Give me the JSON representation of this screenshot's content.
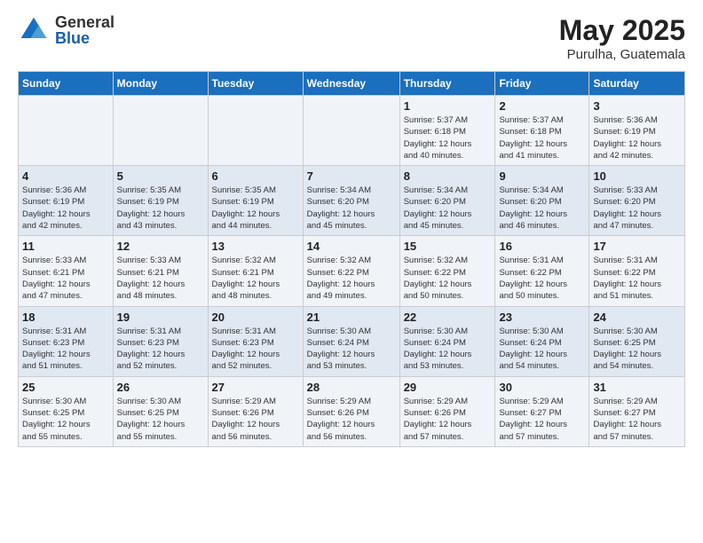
{
  "logo": {
    "general": "General",
    "blue": "Blue"
  },
  "title": "May 2025",
  "location": "Purulha, Guatemala",
  "days_of_week": [
    "Sunday",
    "Monday",
    "Tuesday",
    "Wednesday",
    "Thursday",
    "Friday",
    "Saturday"
  ],
  "weeks": [
    [
      {
        "day": "",
        "info": ""
      },
      {
        "day": "",
        "info": ""
      },
      {
        "day": "",
        "info": ""
      },
      {
        "day": "",
        "info": ""
      },
      {
        "day": "1",
        "info": "Sunrise: 5:37 AM\nSunset: 6:18 PM\nDaylight: 12 hours\nand 40 minutes."
      },
      {
        "day": "2",
        "info": "Sunrise: 5:37 AM\nSunset: 6:18 PM\nDaylight: 12 hours\nand 41 minutes."
      },
      {
        "day": "3",
        "info": "Sunrise: 5:36 AM\nSunset: 6:19 PM\nDaylight: 12 hours\nand 42 minutes."
      }
    ],
    [
      {
        "day": "4",
        "info": "Sunrise: 5:36 AM\nSunset: 6:19 PM\nDaylight: 12 hours\nand 42 minutes."
      },
      {
        "day": "5",
        "info": "Sunrise: 5:35 AM\nSunset: 6:19 PM\nDaylight: 12 hours\nand 43 minutes."
      },
      {
        "day": "6",
        "info": "Sunrise: 5:35 AM\nSunset: 6:19 PM\nDaylight: 12 hours\nand 44 minutes."
      },
      {
        "day": "7",
        "info": "Sunrise: 5:34 AM\nSunset: 6:20 PM\nDaylight: 12 hours\nand 45 minutes."
      },
      {
        "day": "8",
        "info": "Sunrise: 5:34 AM\nSunset: 6:20 PM\nDaylight: 12 hours\nand 45 minutes."
      },
      {
        "day": "9",
        "info": "Sunrise: 5:34 AM\nSunset: 6:20 PM\nDaylight: 12 hours\nand 46 minutes."
      },
      {
        "day": "10",
        "info": "Sunrise: 5:33 AM\nSunset: 6:20 PM\nDaylight: 12 hours\nand 47 minutes."
      }
    ],
    [
      {
        "day": "11",
        "info": "Sunrise: 5:33 AM\nSunset: 6:21 PM\nDaylight: 12 hours\nand 47 minutes."
      },
      {
        "day": "12",
        "info": "Sunrise: 5:33 AM\nSunset: 6:21 PM\nDaylight: 12 hours\nand 48 minutes."
      },
      {
        "day": "13",
        "info": "Sunrise: 5:32 AM\nSunset: 6:21 PM\nDaylight: 12 hours\nand 48 minutes."
      },
      {
        "day": "14",
        "info": "Sunrise: 5:32 AM\nSunset: 6:22 PM\nDaylight: 12 hours\nand 49 minutes."
      },
      {
        "day": "15",
        "info": "Sunrise: 5:32 AM\nSunset: 6:22 PM\nDaylight: 12 hours\nand 50 minutes."
      },
      {
        "day": "16",
        "info": "Sunrise: 5:31 AM\nSunset: 6:22 PM\nDaylight: 12 hours\nand 50 minutes."
      },
      {
        "day": "17",
        "info": "Sunrise: 5:31 AM\nSunset: 6:22 PM\nDaylight: 12 hours\nand 51 minutes."
      }
    ],
    [
      {
        "day": "18",
        "info": "Sunrise: 5:31 AM\nSunset: 6:23 PM\nDaylight: 12 hours\nand 51 minutes."
      },
      {
        "day": "19",
        "info": "Sunrise: 5:31 AM\nSunset: 6:23 PM\nDaylight: 12 hours\nand 52 minutes."
      },
      {
        "day": "20",
        "info": "Sunrise: 5:31 AM\nSunset: 6:23 PM\nDaylight: 12 hours\nand 52 minutes."
      },
      {
        "day": "21",
        "info": "Sunrise: 5:30 AM\nSunset: 6:24 PM\nDaylight: 12 hours\nand 53 minutes."
      },
      {
        "day": "22",
        "info": "Sunrise: 5:30 AM\nSunset: 6:24 PM\nDaylight: 12 hours\nand 53 minutes."
      },
      {
        "day": "23",
        "info": "Sunrise: 5:30 AM\nSunset: 6:24 PM\nDaylight: 12 hours\nand 54 minutes."
      },
      {
        "day": "24",
        "info": "Sunrise: 5:30 AM\nSunset: 6:25 PM\nDaylight: 12 hours\nand 54 minutes."
      }
    ],
    [
      {
        "day": "25",
        "info": "Sunrise: 5:30 AM\nSunset: 6:25 PM\nDaylight: 12 hours\nand 55 minutes."
      },
      {
        "day": "26",
        "info": "Sunrise: 5:30 AM\nSunset: 6:25 PM\nDaylight: 12 hours\nand 55 minutes."
      },
      {
        "day": "27",
        "info": "Sunrise: 5:29 AM\nSunset: 6:26 PM\nDaylight: 12 hours\nand 56 minutes."
      },
      {
        "day": "28",
        "info": "Sunrise: 5:29 AM\nSunset: 6:26 PM\nDaylight: 12 hours\nand 56 minutes."
      },
      {
        "day": "29",
        "info": "Sunrise: 5:29 AM\nSunset: 6:26 PM\nDaylight: 12 hours\nand 57 minutes."
      },
      {
        "day": "30",
        "info": "Sunrise: 5:29 AM\nSunset: 6:27 PM\nDaylight: 12 hours\nand 57 minutes."
      },
      {
        "day": "31",
        "info": "Sunrise: 5:29 AM\nSunset: 6:27 PM\nDaylight: 12 hours\nand 57 minutes."
      }
    ]
  ]
}
